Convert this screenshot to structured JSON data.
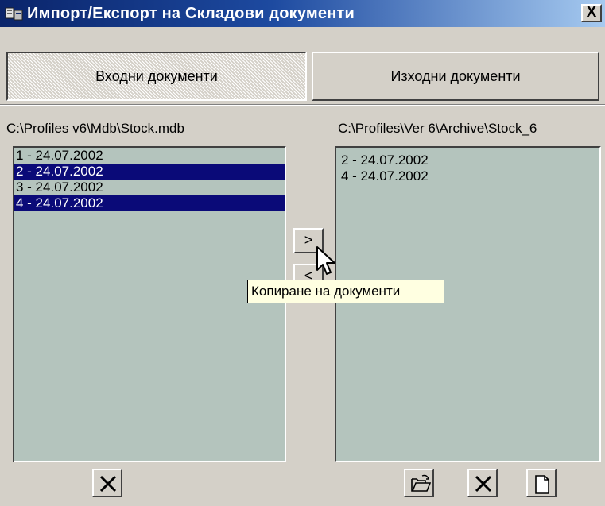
{
  "window": {
    "title": "Импорт/Експорт на Складови документи",
    "close_label": "X"
  },
  "tabs": [
    {
      "label": "Входни документи",
      "active": true
    },
    {
      "label": "Изходни документи",
      "active": false
    }
  ],
  "source": {
    "path": "C:\\Profiles v6\\Mdb\\Stock.mdb",
    "items": [
      {
        "label": "1 - 24.07.2002",
        "selected": false
      },
      {
        "label": "2 - 24.07.2002",
        "selected": true
      },
      {
        "label": "3 - 24.07.2002",
        "selected": false
      },
      {
        "label": "4 - 24.07.2002",
        "selected": true
      }
    ]
  },
  "destination": {
    "path": "C:\\Profiles\\Ver 6\\Archive\\Stock_6",
    "items": [
      {
        "label": "2 - 24.07.2002"
      },
      {
        "label": "4 - 24.07.2002"
      }
    ]
  },
  "transfer": {
    "copy_label": ">",
    "back_label": "<"
  },
  "tooltip": "Копиране на документи",
  "icons": {
    "window": "window-app-icon",
    "delete": "delete-x-icon",
    "open": "open-folder-icon",
    "new": "new-document-icon",
    "cursor": "mouse-pointer-icon"
  },
  "colors": {
    "list_background": "#b4c4bd",
    "selection": "#0a0a78",
    "title_start": "#0a246a",
    "title_end": "#a6caf0"
  }
}
